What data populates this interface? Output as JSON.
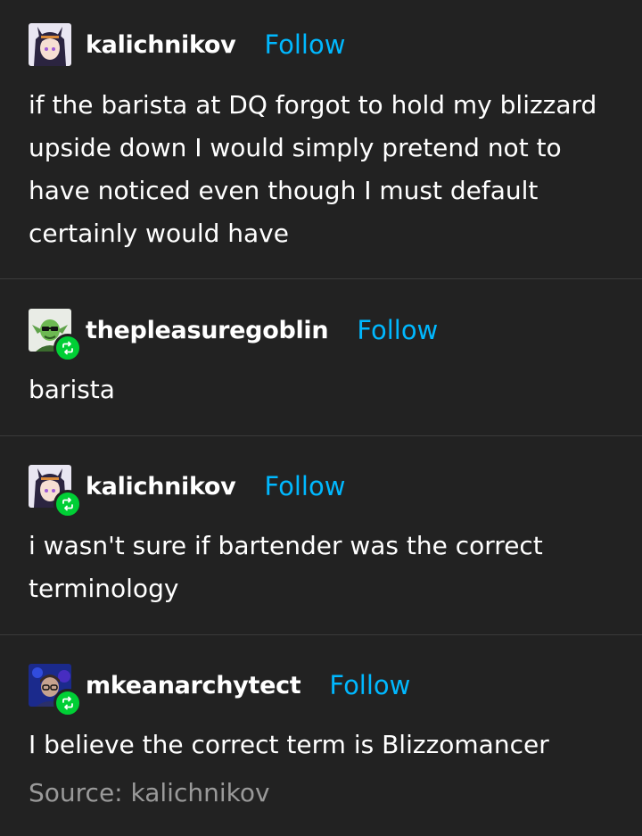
{
  "posts": [
    {
      "username": "kalichnikov",
      "follow_label": "Follow",
      "body": "if the barista at DQ forgot to hold my blizzard upside down I would simply pretend not to have noticed even though I must default certainly would have",
      "avatar_icon": "anime-avatar-icon",
      "reblog": false
    },
    {
      "username": "thepleasuregoblin",
      "follow_label": "Follow",
      "body": "barista",
      "avatar_icon": "goblin-avatar-icon",
      "reblog": true
    },
    {
      "username": "kalichnikov",
      "follow_label": "Follow",
      "body": "i wasn't sure if bartender was the correct terminology",
      "avatar_icon": "anime-avatar-icon",
      "reblog": true
    },
    {
      "username": "mkeanarchytect",
      "follow_label": "Follow",
      "body": "I believe the correct term is Blizzomancer",
      "avatar_icon": "person-avatar-icon",
      "reblog": true
    }
  ],
  "source_label": "Source: kalichnikov",
  "colors": {
    "background": "#222222",
    "follow": "#00b8ff",
    "reblog_badge": "#00cf35",
    "source": "#9a9a9a",
    "divider": "#3a3a3a"
  }
}
